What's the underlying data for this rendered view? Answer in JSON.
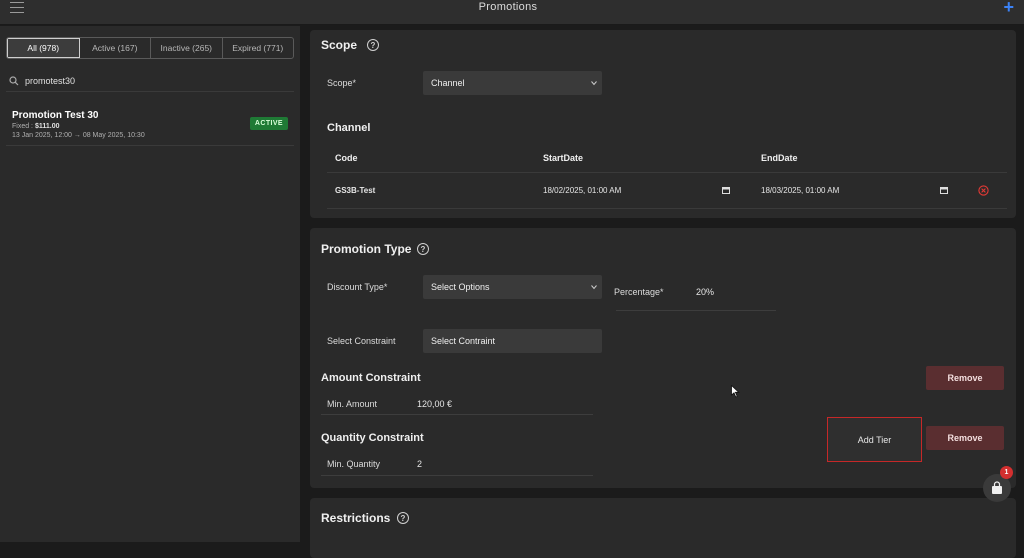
{
  "header": {
    "title": "Promotions",
    "menu_icon": "menu-icon",
    "add_icon": "plus-icon"
  },
  "filters": {
    "tabs": [
      {
        "label": "All (978)",
        "active": true
      },
      {
        "label": "Active (167)",
        "active": false
      },
      {
        "label": "Inactive (265)",
        "active": false
      },
      {
        "label": "Expired (771)",
        "active": false
      }
    ]
  },
  "search": {
    "value": "promotest30"
  },
  "promotions": [
    {
      "name": "Promotion Test 30",
      "fixed_label": "Fixed : ",
      "fixed_value": "$111.00",
      "dates": "13 Jan 2025, 12:00 → 08 May 2025, 10:30",
      "status": "ACTIVE",
      "status_color": "#1f7a35"
    }
  ],
  "scope": {
    "title": "Scope",
    "scope_label": "Scope*",
    "scope_value": "Channel",
    "channel_title": "Channel",
    "columns": [
      "Code",
      "StartDate",
      "EndDate"
    ],
    "rows": [
      {
        "code": "GS3B-Test",
        "start": "18/02/2025, 01:00 AM",
        "end": "18/03/2025, 01:00 AM"
      }
    ]
  },
  "promotion_type": {
    "title": "Promotion Type",
    "discount_label": "Discount Type*",
    "discount_value": "Select Options",
    "percentage_label": "Percentage*",
    "percentage_value": "20%",
    "constraint_label": "Select Constraint",
    "constraint_value": "Select Contraint",
    "amount_title": "Amount Constraint",
    "amount_label": "Min. Amount",
    "amount_value": "120,00 €",
    "quantity_title": "Quantity Constraint",
    "quantity_label": "Min. Quantity",
    "quantity_value": "2",
    "remove_label": "Remove",
    "add_tier_label": "Add Tier"
  },
  "restrictions": {
    "title": "Restrictions"
  },
  "cart": {
    "badge": "1"
  },
  "colors": {
    "accent": "#3b82f6",
    "danger": "#c62828",
    "remove_bg": "#5a2e30",
    "active_green": "#1f7a35"
  }
}
